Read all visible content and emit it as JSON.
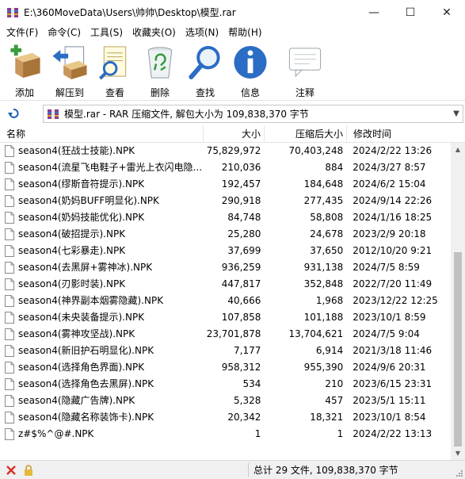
{
  "window": {
    "title": "E:\\360MoveData\\Users\\帅帅\\Desktop\\模型.rar",
    "minimize_glyph": "—",
    "maximize_glyph": "☐",
    "close_glyph": "✕"
  },
  "menu": [
    {
      "label": "文件(F)"
    },
    {
      "label": "命令(C)"
    },
    {
      "label": "工具(S)"
    },
    {
      "label": "收藏夹(O)"
    },
    {
      "label": "选项(N)"
    },
    {
      "label": "帮助(H)"
    }
  ],
  "toolbar": [
    {
      "label": "添加",
      "icon": "add-icon"
    },
    {
      "label": "解压到",
      "icon": "extract-to-icon"
    },
    {
      "label": "查看",
      "icon": "view-icon"
    },
    {
      "label": "删除",
      "icon": "delete-icon"
    },
    {
      "label": "查找",
      "icon": "find-icon"
    },
    {
      "label": "信息",
      "icon": "info-icon"
    },
    {
      "label": "注释",
      "icon": "comment-icon"
    }
  ],
  "address": {
    "text": "模型.rar - RAR 压缩文件, 解包大小为 109,838,370 字节"
  },
  "columns": {
    "name": "名称",
    "size": "大小",
    "packed": "压缩后大小",
    "modified": "修改时间"
  },
  "files": [
    {
      "name": "season4(狂战士技能).NPK",
      "size": "75,829,972",
      "packed": "70,403,248",
      "modified": "2024/2/22 13:26"
    },
    {
      "name": "season4(流星飞电鞋子+雷光上衣闪电隐...",
      "size": "210,036",
      "packed": "884",
      "modified": "2024/3/27 8:57"
    },
    {
      "name": "season4(缪斯音符提示).NPK",
      "size": "192,457",
      "packed": "184,648",
      "modified": "2024/6/2 15:04"
    },
    {
      "name": "season4(奶妈BUFF明显化).NPK",
      "size": "290,918",
      "packed": "277,435",
      "modified": "2024/9/14 22:26"
    },
    {
      "name": "season4(奶妈技能优化).NPK",
      "size": "84,748",
      "packed": "58,808",
      "modified": "2024/1/16 18:25"
    },
    {
      "name": "season4(破招提示).NPK",
      "size": "25,280",
      "packed": "24,678",
      "modified": "2023/2/9 20:18"
    },
    {
      "name": "season4(七彩暴走).NPK",
      "size": "37,699",
      "packed": "37,650",
      "modified": "2012/10/20 9:21"
    },
    {
      "name": "season4(去黑屏+雾神冰).NPK",
      "size": "936,259",
      "packed": "931,138",
      "modified": "2024/7/5 8:59"
    },
    {
      "name": "season4(刃影时装).NPK",
      "size": "447,817",
      "packed": "352,848",
      "modified": "2022/7/20 11:49"
    },
    {
      "name": "season4(神界副本烟雾隐藏).NPK",
      "size": "40,666",
      "packed": "1,968",
      "modified": "2023/12/22 12:25"
    },
    {
      "name": "season4(未央装备提示).NPK",
      "size": "107,858",
      "packed": "101,188",
      "modified": "2023/10/1 8:59"
    },
    {
      "name": "season4(雾神攻坚战).NPK",
      "size": "23,701,878",
      "packed": "13,704,621",
      "modified": "2024/7/5 9:04"
    },
    {
      "name": "season4(新旧护石明显化).NPK",
      "size": "7,177",
      "packed": "6,914",
      "modified": "2021/3/18 11:46"
    },
    {
      "name": "season4(选择角色界面).NPK",
      "size": "958,312",
      "packed": "955,390",
      "modified": "2024/9/6 20:31"
    },
    {
      "name": "season4(选择角色去黑屏).NPK",
      "size": "534",
      "packed": "210",
      "modified": "2023/6/15 23:31"
    },
    {
      "name": "season4(隐藏广告牌).NPK",
      "size": "5,328",
      "packed": "457",
      "modified": "2023/5/1 15:11"
    },
    {
      "name": "season4(隐藏名称装饰卡).NPK",
      "size": "20,342",
      "packed": "18,321",
      "modified": "2023/10/1 8:54"
    },
    {
      "name": "z#$%^@#.NPK",
      "size": "1",
      "packed": "1",
      "modified": "2024/2/22 13:13"
    }
  ],
  "status": {
    "text": "总计 29 文件, 109,838,370 字节"
  },
  "colors": {
    "accent_blue": "#1a5fb4",
    "selection": "#cce8ff"
  }
}
